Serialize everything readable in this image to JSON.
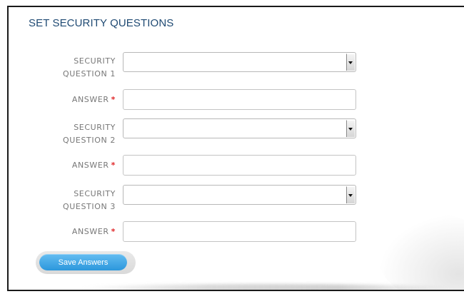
{
  "form": {
    "title": "SET SECURITY QUESTIONS",
    "questions": [
      {
        "label_line1": "SECURITY",
        "label_line2": "QUESTION 1",
        "selected": "",
        "answer_label": "ANSWER",
        "answer_value": ""
      },
      {
        "label_line1": "SECURITY",
        "label_line2": "QUESTION 2",
        "selected": "",
        "answer_label": "ANSWER",
        "answer_value": ""
      },
      {
        "label_line1": "SECURITY",
        "label_line2": "QUESTION 3",
        "selected": "",
        "answer_label": "ANSWER",
        "answer_value": ""
      }
    ],
    "required_marker": "*",
    "save_label": "Save Answers"
  },
  "colors": {
    "title": "#1f4a73",
    "required": "#e0292b",
    "button": "#2c97dc"
  }
}
